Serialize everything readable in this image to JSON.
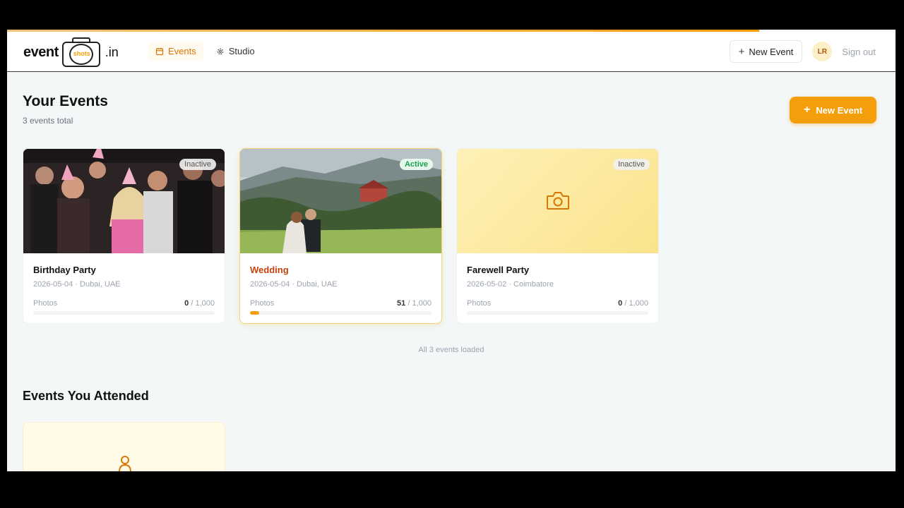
{
  "header": {
    "logo": {
      "word": "event",
      "badge": "shots",
      "tld": ".in"
    },
    "nav": [
      {
        "label": "Events",
        "icon": "calendar-icon",
        "active": true
      },
      {
        "label": "Studio",
        "icon": "gear-icon",
        "active": false
      }
    ],
    "new_event_label": "New Event",
    "avatar_initials": "LR",
    "sign_out_label": "Sign out"
  },
  "main": {
    "title": "Your Events",
    "subtitle": "3 events total",
    "new_event_label": "New Event",
    "events": [
      {
        "name": "Birthday Party",
        "meta": "2026-05-04 · Dubai, UAE",
        "status": "Inactive",
        "photos_label": "Photos",
        "count": "0",
        "limit": "/ 1,000",
        "progress": 0.0
      },
      {
        "name": "Wedding",
        "meta": "2026-05-04 · Dubai, UAE",
        "status": "Active",
        "photos_label": "Photos",
        "count": "51",
        "limit": "/ 1,000",
        "progress": 0.051
      },
      {
        "name": "Farewell Party",
        "meta": "2026-05-02 · Coimbatore",
        "status": "Inactive",
        "photos_label": "Photos",
        "count": "0",
        "limit": "/ 1,000",
        "progress": 0.0
      }
    ],
    "loaded_note": "All 3 events loaded",
    "attended_title": "Events You Attended"
  },
  "colors": {
    "accent": "#f59e0b",
    "active_green": "#16a34a"
  }
}
